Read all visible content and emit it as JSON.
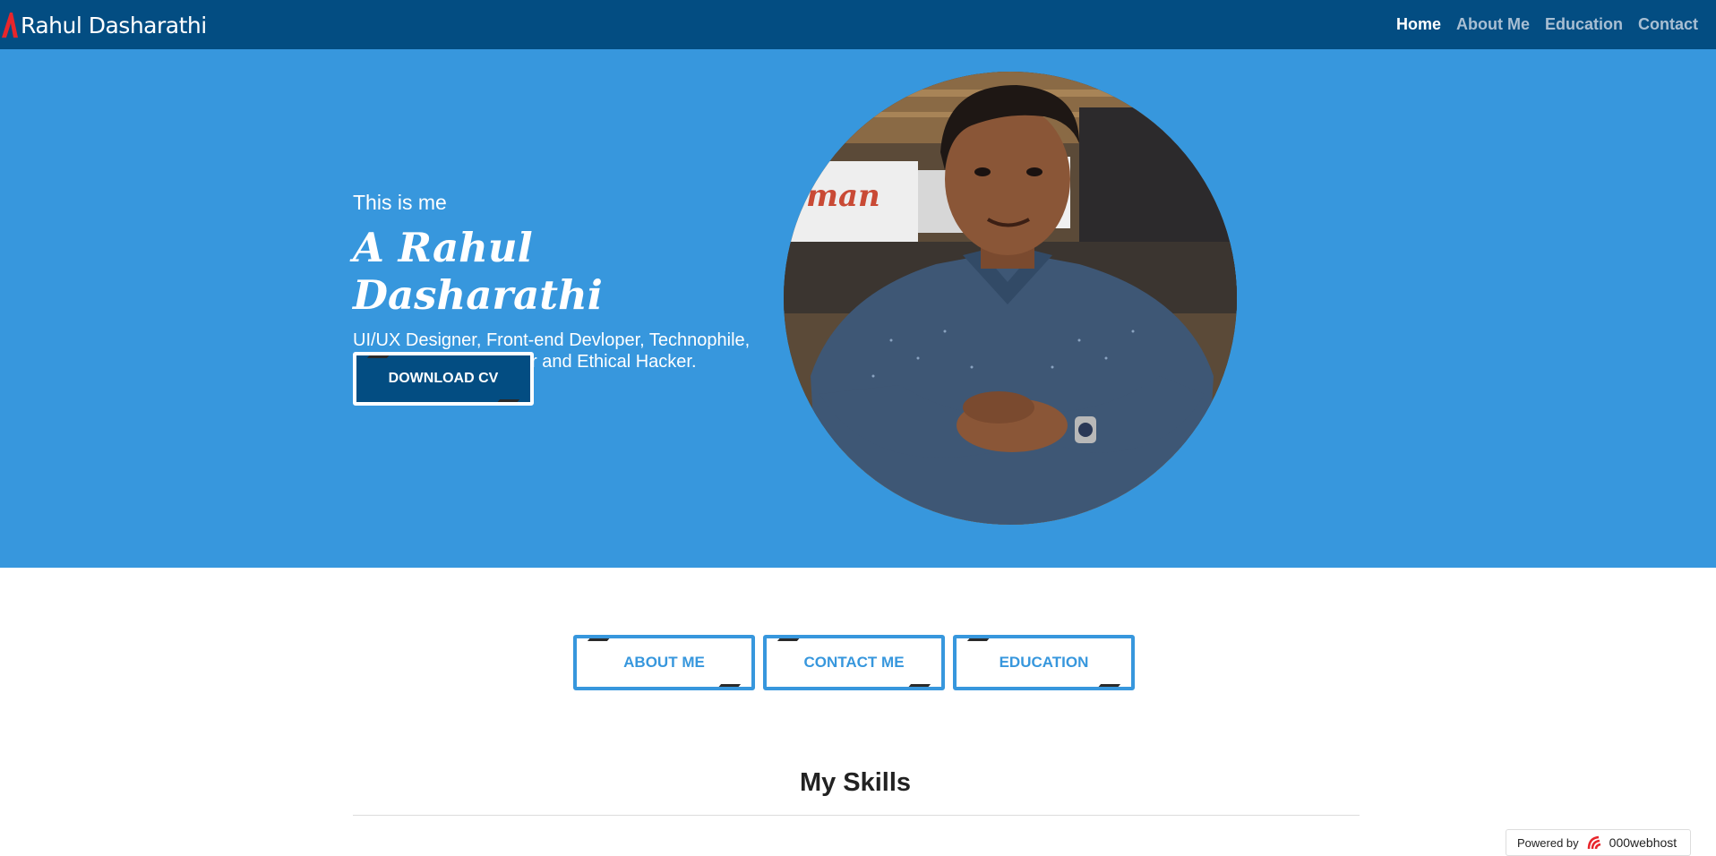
{
  "navbar": {
    "brand": "Rahul Dasharathi",
    "links": [
      {
        "label": "Home",
        "active": true
      },
      {
        "label": "About Me",
        "active": false
      },
      {
        "label": "Education",
        "active": false
      },
      {
        "label": "Contact",
        "active": false
      }
    ]
  },
  "hero": {
    "subtitle": "This is me",
    "name": "A Rahul Dasharathi",
    "description": "UI/UX Designer, Front-end Devloper, Technophile, Cyber Security Beginer and Ethical Hacker.",
    "cv_button": "DOWNLOAD CV",
    "portrait_icon": "profile-photo"
  },
  "actions": {
    "about": "ABOUT ME",
    "contact": "CONTACT ME",
    "education": "EDUCATION"
  },
  "skills": {
    "title": "My Skills"
  },
  "footer_badge": {
    "powered_by": "Powered by",
    "host": "000webhost"
  },
  "colors": {
    "navbar": "#034d82",
    "hero": "#3797dd",
    "accent": "#3797dd",
    "brand_mark": "#e8262c"
  }
}
